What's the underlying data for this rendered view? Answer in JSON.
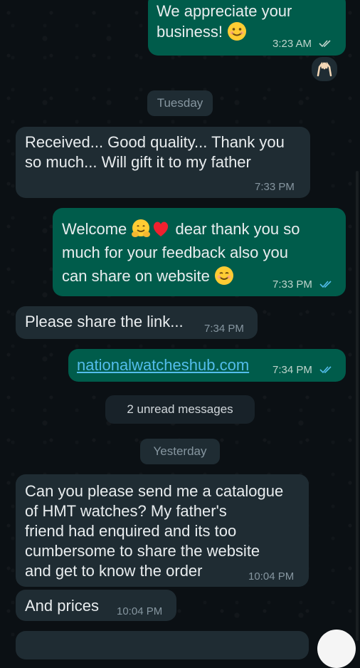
{
  "colors": {
    "background": "#0b1014",
    "incoming_bubble": "#1f2c33",
    "outgoing_bubble": "#005c4b",
    "read_ticks": "#53bdeb",
    "link": "#53bdeb"
  },
  "messages": [
    {
      "direction": "out",
      "text_line1": "We appreciate your",
      "text_line2": "business!",
      "time": "3:23 AM",
      "status": "delivered",
      "reaction_icon": "raising-hands-icon"
    },
    {
      "direction": "in",
      "text_line1": "Received... Good quality... Thank you",
      "text_line2": "so much... Will gift it to my father",
      "time": "7:33 PM"
    },
    {
      "direction": "out",
      "text_line1_a": "Welcome",
      "text_line1_b": "dear thank you so",
      "text_line2": "much for your feedback also you",
      "text_line3": "can share on website",
      "time": "7:33 PM",
      "status": "read"
    },
    {
      "direction": "in",
      "text": "Please share the link...",
      "time": "7:34 PM"
    },
    {
      "direction": "out",
      "link": "nationalwatcheshub.com",
      "time": "7:34 PM",
      "status": "read"
    },
    {
      "direction": "in",
      "line1": "Can you please send me a catalogue",
      "line2": "of HMT watches? My father's",
      "line3": "friend had enquired and its too",
      "line4": "cumbersome to share the website",
      "line5": "and get to know the order",
      "time": "10:04 PM"
    },
    {
      "direction": "in",
      "text": "And prices",
      "time": "10:04 PM"
    }
  ],
  "date_separators": {
    "tuesday": "Tuesday",
    "yesterday": "Yesterday"
  },
  "unread_banner": "2 unread messages"
}
